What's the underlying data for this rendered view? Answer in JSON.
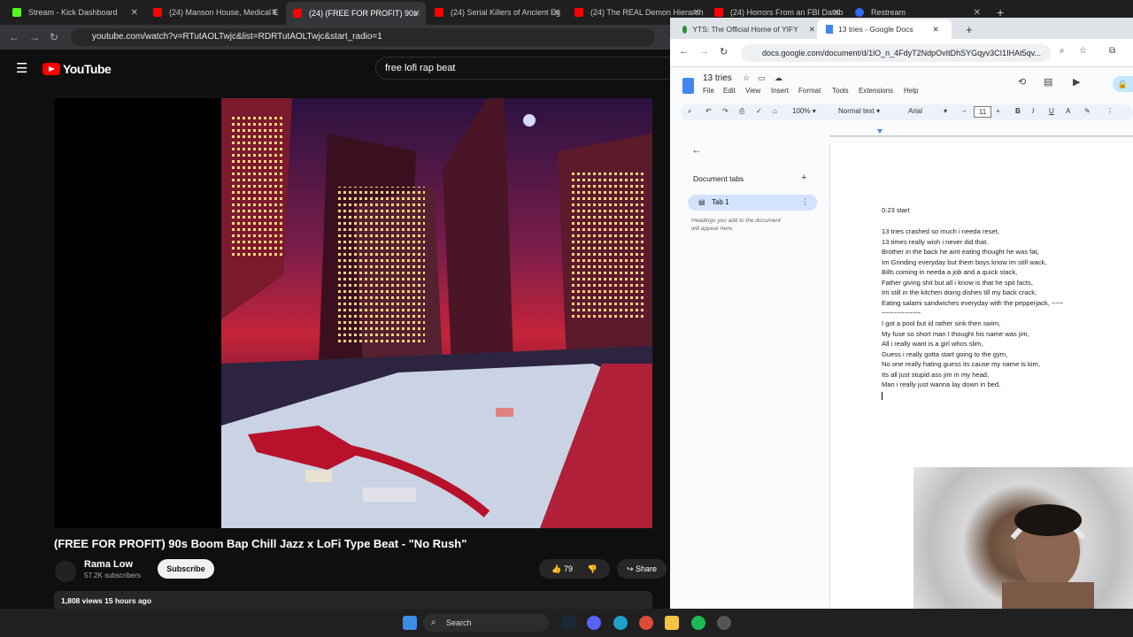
{
  "browser_tabs": [
    {
      "label": "Stream - Kick Dashboard",
      "color": "#53fc18"
    },
    {
      "label": "(24) Manson House, Medical E",
      "color": "#ff0000"
    },
    {
      "label": "(24) (FREE FOR PROFIT) 90s",
      "color": "#ff0000",
      "active": true
    },
    {
      "label": "(24) Serial Killers of Ancient Eg",
      "color": "#ff0000"
    },
    {
      "label": "(24) The REAL Demon Hierarch",
      "color": "#ff0000"
    },
    {
      "label": "(24) Horrors From an FBI Datab",
      "color": "#ff0000"
    },
    {
      "label": "Restream",
      "color": "#2f6df6"
    }
  ],
  "youtube": {
    "url": "youtube.com/watch?v=RTutAOLTwjc&list=RDRTutAOLTwjc&start_radio=1",
    "logo": "YouTube",
    "search_value": "free lofi rap beat",
    "video_title": "(FREE FOR PROFIT) 90s Boom Bap Chill Jazz x LoFi Type Beat - \"No Rush\"",
    "channel": "Rama Low",
    "subscribers": "57.2K subscribers",
    "subscribe_label": "Subscribe",
    "likes": "79",
    "share_label": "Share",
    "views": "1,808 views  15 hours ago"
  },
  "docs": {
    "tabs": [
      {
        "label": "YTS: The Official Home of YIFY"
      },
      {
        "label": "13 tries - Google Docs",
        "active": true
      }
    ],
    "url": "docs.google.com/document/d/1lO_n_4FdyT2NdpOvItDhSYGqyv3CI1IHAt5qv...",
    "title": "13 tries",
    "menu": [
      "File",
      "Edit",
      "View",
      "Insert",
      "Format",
      "Tools",
      "Extensions",
      "Help"
    ],
    "zoom": "100%",
    "style": "Normal text",
    "font": "Arial",
    "font_size": "11",
    "outline_header": "Document tabs",
    "outline_tab": "Tab 1",
    "outline_hint_1": "Headings you add to the document",
    "outline_hint_2": "will appear here.",
    "lines": [
      "0:23 start",
      "",
      "13 tries crashed so much i needa reset,",
      "13 times really wish i never did that.",
      "Brother in the back he aint eating thought he was fat,",
      "Im Grinding everyday but them boys know im still wack,",
      "Bills coming in needa a job and a quick stack,",
      "Father giving shit but all i know is that he spit facts,",
      "Im still in the kitchen doing dishes till my back crack,",
      "Eating salami sandwiches everyday with the pepperjack, ~~~",
      "~~~~~~~~~~",
      "I got a pool but id rather sink then swim,",
      "My fuse so short man I thought his name was jim,",
      "All i really want is a girl whos slim,",
      "Guess i really gotta start going to the gym,",
      "No one really hating guess its cause my name is kim,",
      "Its all just stupid ass jim in my head,",
      "Man i really just wanna lay down in bed,"
    ]
  },
  "taskbar": {
    "search_label": "Search"
  }
}
